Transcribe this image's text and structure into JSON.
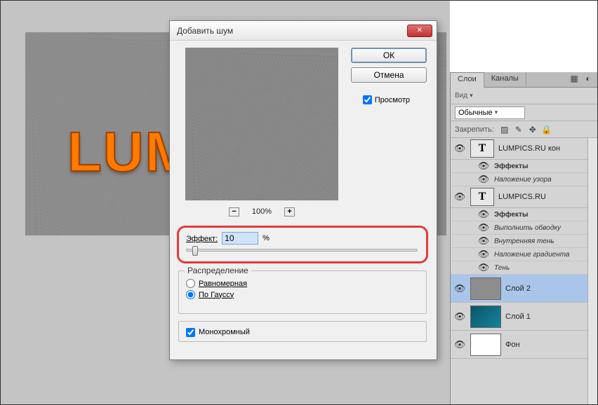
{
  "canvas": {
    "text": "LUM"
  },
  "dialog": {
    "title": "Добавить шум",
    "ok_label": "ОК",
    "cancel_label": "Отмена",
    "preview_label": "Просмотр",
    "zoom_label": "100%",
    "effect_label": "Эффект:",
    "effect_value": "10",
    "effect_unit": "%",
    "distribution_legend": "Распределение",
    "dist_uniform": "Равномерная",
    "dist_gaussian": "По Гауссу",
    "monochrome_label": "Монохромный"
  },
  "layers_panel": {
    "tabs": {
      "layers": "Слои",
      "channels": "Каналы"
    },
    "kind_label": "Вид",
    "blend_mode": "Обычные",
    "lock_label": "Закрепить:",
    "layers": [
      {
        "name": "LUMPICS.RU кон",
        "type": "text",
        "fx": [
          "Эффекты",
          "Наложение узора"
        ]
      },
      {
        "name": "LUMPICS.RU",
        "type": "text",
        "fx": [
          "Эффекты",
          "Выполнить обводку",
          "Внутренняя тень",
          "Наложение градиента",
          "Тень"
        ]
      },
      {
        "name": "Слой 2",
        "type": "gray",
        "selected": true
      },
      {
        "name": "Слой 1",
        "type": "teal"
      },
      {
        "name": "Фон",
        "type": "white"
      }
    ]
  }
}
